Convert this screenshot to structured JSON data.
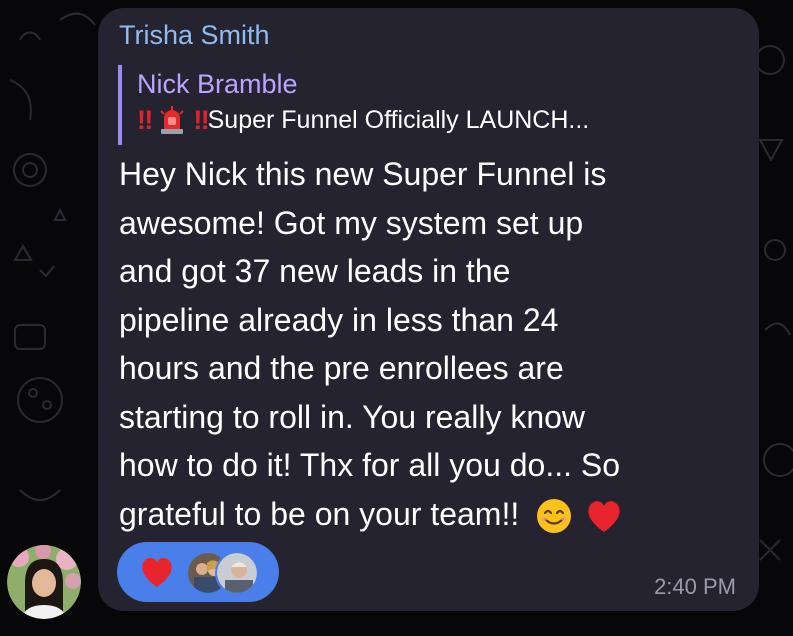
{
  "message": {
    "sender_name": "Trisha Smith",
    "reply": {
      "author": "Nick Bramble",
      "bang1": "‼",
      "bang2": "‼",
      "preview_text": " Super Funnel Officially LAUNCH..."
    },
    "lines": [
      "Hey Nick this new Super Funnel is",
      "awesome! Got my system set up",
      "and got 37 new leads in the",
      "pipeline already in less than 24",
      "hours and the pre enrollees are",
      "starting to roll in. You really know",
      "how to do it! Thx for all you do... So",
      "grateful to be on your team!!"
    ],
    "timestamp": "2:40 PM",
    "reaction": {
      "emoji_icon": "heart-icon",
      "reactor_count_avatars": 2
    }
  },
  "colors": {
    "bubble": "#24232f",
    "sender": "#8ebcf0",
    "reply_accent": "#9b8bf2",
    "reaction_pill": "#4a7ee9",
    "heart": "#e8252c"
  }
}
